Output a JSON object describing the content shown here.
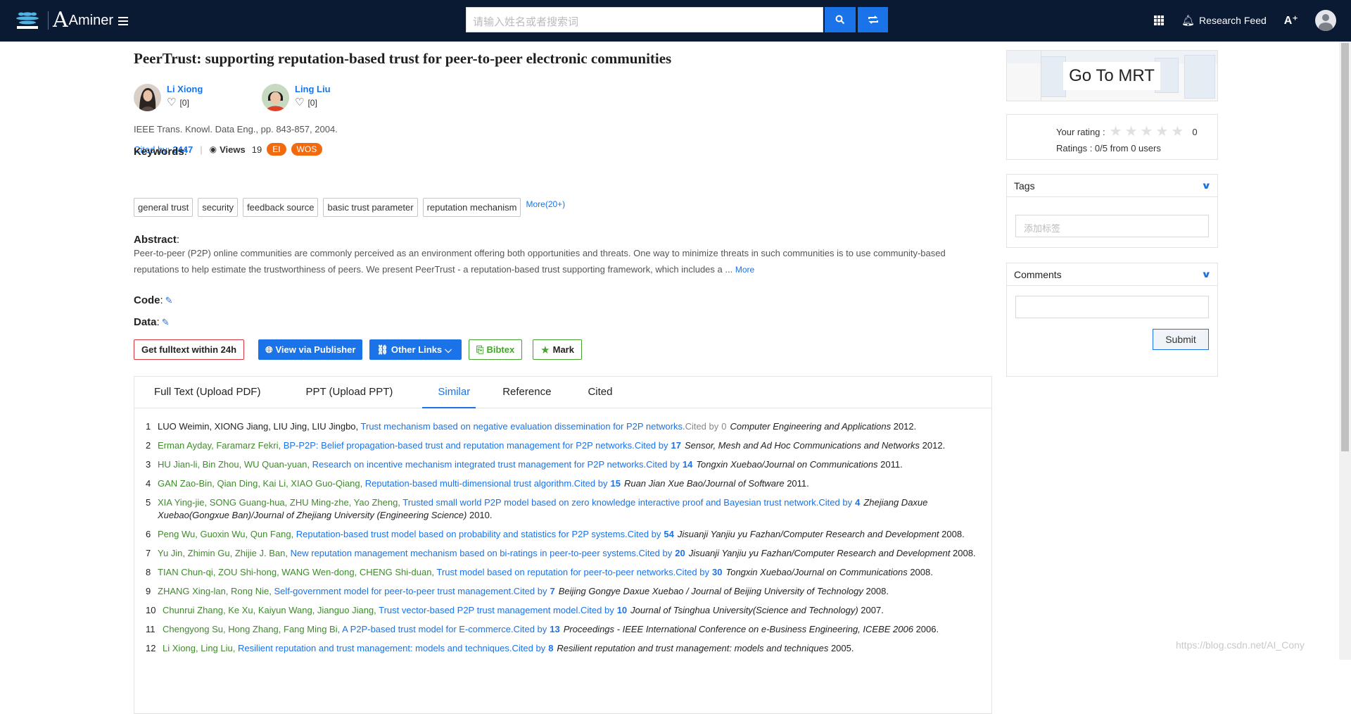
{
  "nav": {
    "brand": "Aminer",
    "search_placeholder": "请输入姓名或者搜索词",
    "research_feed": "Research Feed",
    "icons": [
      "acemap-logo",
      "aminer-logo",
      "menu-icon",
      "search-icon",
      "switch-icon",
      "apps-grid-icon",
      "bell-icon",
      "translate-icon",
      "user-avatar-icon"
    ]
  },
  "paper": {
    "title": "PeerTrust: supporting reputation-based trust for peer-to-peer electronic communities",
    "authors": [
      {
        "name": "Li Xiong",
        "likes": "[0]"
      },
      {
        "name": "Ling Liu",
        "likes": "[0]"
      }
    ],
    "venue": "IEEE Trans. Knowl. Data Eng., pp. 843-857, 2004.",
    "cited_label": "Cited by:",
    "cited_count": "2447",
    "views_label": "Views",
    "views_count": "19",
    "badges": [
      "EI",
      "WOS"
    ],
    "keywords_heading": "Keywords",
    "keywords": [
      "general trust",
      "security",
      "feedback source",
      "basic trust parameter",
      "reputation mechanism"
    ],
    "keywords_more": "More(20+)",
    "abstract_heading": "Abstract",
    "abstract": "Peer-to-peer (P2P) online communities are commonly perceived as an environment offering both opportunities and threats. One way to minimize threats in such communities is to use community-based reputations to help estimate the trustworthiness of peers. We present PeerTrust - a reputation-based trust supporting framework, which includes a ...",
    "abstract_more": "More",
    "code_heading": "Code",
    "data_heading": "Data"
  },
  "actions": {
    "fulltext": "Get fulltext within 24h",
    "publisher": "View via Publisher",
    "other_links": "Other Links",
    "bibtex": "Bibtex",
    "mark": "Mark"
  },
  "tabs": [
    "Full Text (Upload PDF)",
    "PPT (Upload PPT)",
    "Similar",
    "Reference",
    "Cited"
  ],
  "active_tab": "Similar",
  "similar": [
    {
      "n": "1",
      "authors": "LUO Weimin, XIONG Jiang, LIU Jing, LIU Jingbo, ",
      "title": "Trust mechanism based on negative evaluation dissemination for P2P networks.",
      "cited_by": "Cited by",
      "count": "0",
      "journal": "Computer Engineering and Applications",
      "year": " 2012."
    },
    {
      "n": "2",
      "authors": "Erman Ayday, Faramarz Fekri, ",
      "title": "BP-P2P: Belief propagation-based trust and reputation management for P2P networks.",
      "cited_by": "Cited by",
      "count": "17",
      "journal": "Sensor, Mesh and Ad Hoc Communications and Networks",
      "year": " 2012."
    },
    {
      "n": "3",
      "authors": "HU Jian-li, Bin Zhou, WU Quan-yuan, ",
      "title": "Research on incentive mechanism integrated trust management for P2P networks.",
      "cited_by": "Cited by",
      "count": "14",
      "journal": "Tongxin Xuebao/Journal on Communications",
      "year": " 2011."
    },
    {
      "n": "4",
      "authors": "GAN Zao-Bin, Qian Ding, Kai Li, XIAO Guo-Qiang, ",
      "title": "Reputation-based multi-dimensional trust algorithm.",
      "cited_by": "Cited by",
      "count": "15",
      "journal": "Ruan Jian Xue Bao/Journal of Software",
      "year": " 2011."
    },
    {
      "n": "5",
      "authors": "XIA Ying-jie, SONG Guang-hua, ZHU Ming-zhe, Yao Zheng, ",
      "title": "Trusted small world P2P model based on zero knowledge interactive proof and Bayesian trust network.",
      "cited_by": "Cited by",
      "count": "4",
      "journal": "Zhejiang Daxue Xuebao(Gongxue Ban)/Journal of Zhejiang University (Engineering Science)",
      "year": " 2010."
    },
    {
      "n": "6",
      "authors": "Peng Wu, Guoxin Wu, Qun Fang, ",
      "title": "Reputation-based trust model based on probability and statistics for P2P systems.",
      "cited_by": "Cited by",
      "count": "54",
      "journal": "Jisuanji Yanjiu yu Fazhan/Computer Research and Development",
      "year": " 2008."
    },
    {
      "n": "7",
      "authors": "Yu Jin, Zhimin Gu, Zhijie J. Ban, ",
      "title": "New reputation management mechanism based on bi-ratings in peer-to-peer systems.",
      "cited_by": "Cited by",
      "count": "20",
      "journal": "Jisuanji Yanjiu yu Fazhan/Computer Research and Development",
      "year": " 2008."
    },
    {
      "n": "8",
      "authors": "TIAN Chun-qi, ZOU Shi-hong, WANG Wen-dong, CHENG Shi-duan, ",
      "title": "Trust model based on reputation for peer-to-peer networks.",
      "cited_by": "Cited by",
      "count": "30",
      "journal": "Tongxin Xuebao/Journal on Communications",
      "year": " 2008."
    },
    {
      "n": "9",
      "authors": "ZHANG Xing-lan, Rong Nie, ",
      "title": "Self-government model for peer-to-peer trust management.",
      "cited_by": "Cited by",
      "count": "7",
      "journal": "Beijing Gongye Daxue Xuebao / Journal of Beijing University of Technology",
      "year": " 2008."
    },
    {
      "n": "10",
      "authors": "Chunrui Zhang, Ke Xu, Kaiyun Wang, Jianguo Jiang, ",
      "title": "Trust vector-based P2P trust management model.",
      "cited_by": "Cited by",
      "count": "10",
      "journal": "Journal of Tsinghua University(Science and Technology)",
      "year": " 2007."
    },
    {
      "n": "11",
      "authors": "Chengyong Su, Hong Zhang, Fang Ming Bi, ",
      "title": "A P2P-based trust model for E-commerce.",
      "cited_by": "Cited by",
      "count": "13",
      "journal": "Proceedings - IEEE International Conference on e-Business Engineering, ICEBE 2006",
      "year": " 2006."
    },
    {
      "n": "12",
      "authors": "Li Xiong, Ling Liu, ",
      "title": "Resilient reputation and trust management: models and techniques.",
      "cited_by": "Cited by",
      "count": "8",
      "journal": "Resilient reputation and trust management: models and techniques",
      "year": " 2005."
    }
  ],
  "sidebar": {
    "mrt_label": "Go To MRT",
    "rating_label": "Your rating :",
    "rating_value": "0",
    "rating_summary": "Ratings : 0/5 from 0 users",
    "tags_heading": "Tags",
    "tags_placeholder": "添加标签",
    "comments_heading": "Comments",
    "submit": "Submit"
  },
  "watermark": "https://blog.csdn.net/AI_Cony",
  "colors": {
    "nav_bg": "#0b1a33",
    "accent": "#1a73e8",
    "badge": "#f16a0d",
    "author_green": "#3f8b2c"
  }
}
